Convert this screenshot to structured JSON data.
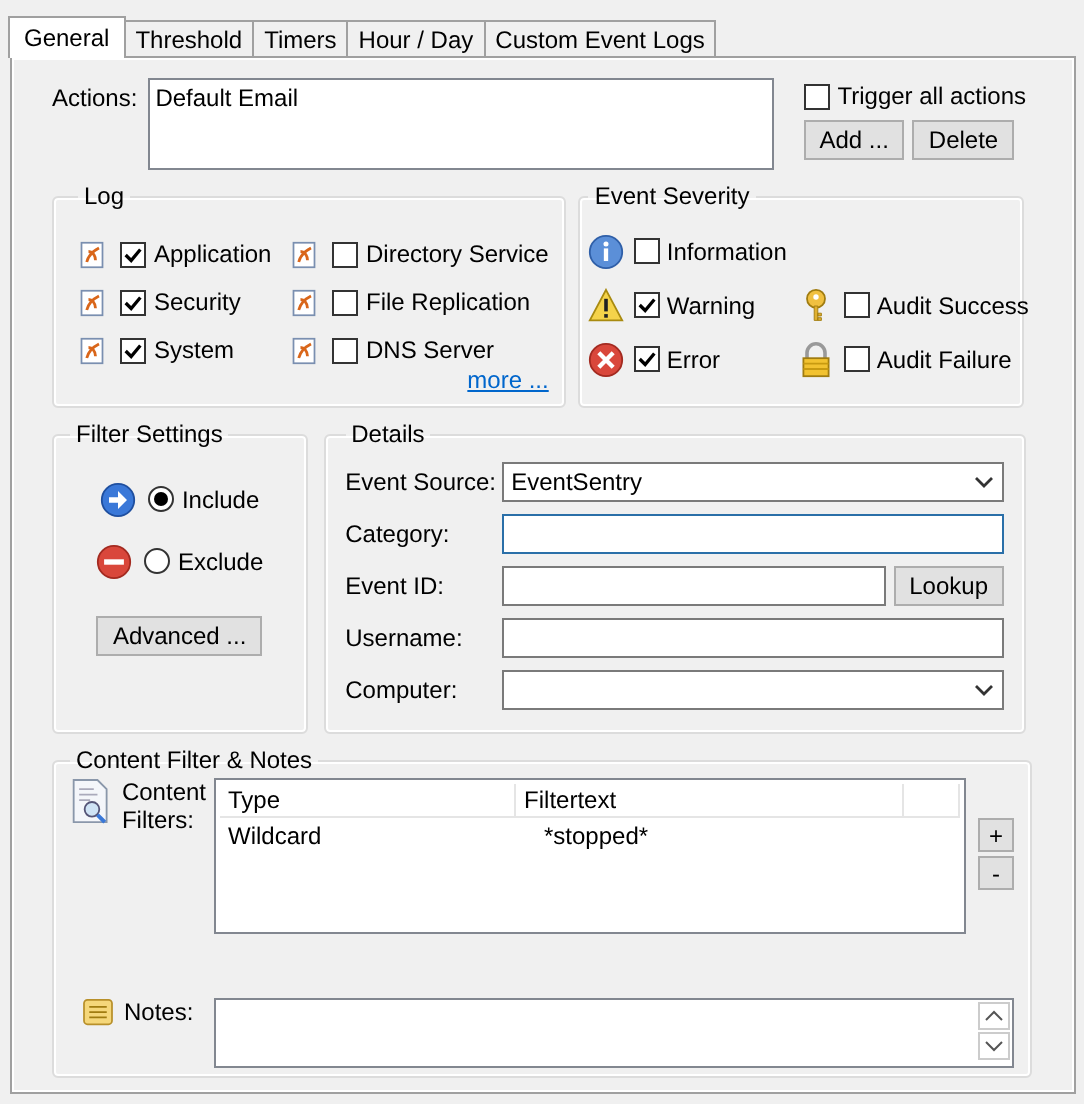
{
  "tabs": [
    {
      "label": "General",
      "selected": true
    },
    {
      "label": "Threshold",
      "selected": false
    },
    {
      "label": "Timers",
      "selected": false
    },
    {
      "label": "Hour / Day",
      "selected": false
    },
    {
      "label": "Custom Event Logs",
      "selected": false
    }
  ],
  "actions": {
    "label": "Actions:",
    "items": [
      "Default Email"
    ]
  },
  "trigger_all": {
    "label": "Trigger all actions",
    "checked": false
  },
  "action_buttons": [
    "Add ...",
    "Delete"
  ],
  "log": {
    "title": "Log",
    "items": [
      {
        "label": "Application",
        "checked": true
      },
      {
        "label": "Security",
        "checked": true
      },
      {
        "label": "System",
        "checked": true
      },
      {
        "label": "Directory Service",
        "checked": false
      },
      {
        "label": "File Replication",
        "checked": false
      },
      {
        "label": "DNS Server",
        "checked": false
      }
    ],
    "more_link": "more ..."
  },
  "severity": {
    "title": "Event Severity",
    "left": [
      {
        "kind": "info",
        "label": "Information",
        "checked": false
      },
      {
        "kind": "warning",
        "label": "Warning",
        "checked": true
      },
      {
        "kind": "error",
        "label": "Error",
        "checked": true
      }
    ],
    "right": [
      {
        "kind": "key",
        "label": "Audit Success",
        "checked": false
      },
      {
        "kind": "lock",
        "label": "Audit Failure",
        "checked": false
      }
    ]
  },
  "filter_settings": {
    "title": "Filter Settings",
    "options": [
      {
        "kind": "include",
        "label": "Include",
        "selected": true
      },
      {
        "kind": "exclude",
        "label": "Exclude",
        "selected": false
      }
    ],
    "button": "Advanced ..."
  },
  "details": {
    "title": "Details",
    "fields": [
      {
        "kind": "combo",
        "label": "Event Source:",
        "value": "EventSentry",
        "focused": false
      },
      {
        "kind": "text",
        "label": "Category:",
        "focused": true
      },
      {
        "kind": "text_button",
        "label": "Event ID:",
        "button": "Lookup",
        "focused": false
      },
      {
        "kind": "text",
        "label": "Username:",
        "focused": false
      },
      {
        "kind": "combo",
        "label": "Computer:",
        "focused": false
      }
    ]
  },
  "content_filter": {
    "title": "Content Filter & Notes",
    "filters_label": [
      "Content",
      "Filters:"
    ],
    "columns": [
      "Type",
      "Filtertext"
    ],
    "rows": [
      [
        "Wildcard",
        "*stopped*"
      ]
    ],
    "buttons": [
      "+",
      "-"
    ],
    "notes_label": "Notes:"
  }
}
